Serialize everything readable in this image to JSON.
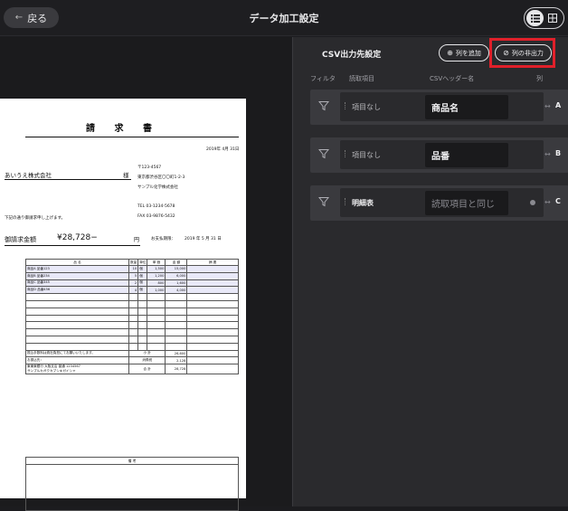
{
  "topbar": {
    "back_label": "戻る",
    "title": "データ加工設定"
  },
  "view_toggle": {
    "options": [
      "list-view",
      "grid-view"
    ],
    "active": "list-view"
  },
  "invoice": {
    "title": "請 求 書",
    "date": "2019年 4月 31日",
    "customer": "あいうえ株式会社",
    "honorific": "様",
    "postal": "〒123-4567",
    "address": "東京都渋谷区〇〇町1-2-3",
    "company": "サンプル化学株式会社",
    "tel": "TEL  03-1234-5678",
    "fax": "FAX  03-9876-5432",
    "greeting": "下記の通り御請求申し上げます。",
    "total_label": "御請求金額",
    "total_value": "¥28,728−",
    "total_unit": "円",
    "due_label": "お支払期限：",
    "due_value": "2019 年  5 月  31 日",
    "columns": [
      "品 名",
      "数量",
      "単位",
      "単 価",
      "金 額",
      "摘 要"
    ],
    "items": [
      {
        "name": "商品A 品番123",
        "qty": "10",
        "unit": "個",
        "price": "1,500",
        "amount": "15,000",
        "note": ""
      },
      {
        "name": "商品B 品番234",
        "qty": "5",
        "unit": "個",
        "price": "1,200",
        "amount": "6,000",
        "note": ""
      },
      {
        "name": "商品C 品番345",
        "qty": "2",
        "unit": "個",
        "price": "800",
        "amount": "1,600",
        "note": ""
      },
      {
        "name": "商品D 品番456",
        "qty": "4",
        "unit": "個",
        "price": "1,000",
        "amount": "4,000",
        "note": ""
      }
    ],
    "transfer_note": "振込手数料は貴社負担にてお願いいたします。",
    "bank_label": "お振込先：",
    "bank_line1": "東東東銀行 大阪支店 普通 1234567",
    "bank_line2": "サンプルカガクカブシキガイシャ",
    "subtotal_label": "小 計",
    "subtotal_value": "26,600",
    "tax_label": "消費税",
    "tax_value": "2,128",
    "grand_label": "合 計",
    "grand_value": "28,728",
    "remarks_label": "備 考"
  },
  "csv": {
    "title": "CSV出力先設定",
    "add_column_label": "列を追加",
    "hide_column_label": "列の非出力",
    "headers": {
      "filter": "フィルタ",
      "source": "読取項目",
      "csv_header": "CSVヘッダー名",
      "column": "列"
    },
    "rows": [
      {
        "source": "項目なし",
        "csv_header": "商品名",
        "placeholder": "",
        "column": "A"
      },
      {
        "source": "項目なし",
        "csv_header": "品番",
        "placeholder": "",
        "column": "B"
      },
      {
        "source": "明細表",
        "csv_header": "",
        "placeholder": "読取項目と同じ",
        "column": "C"
      }
    ]
  },
  "colors": {
    "highlight": "#e0202a",
    "panel": "#2a2a2d",
    "row": "#3a3a3e"
  }
}
